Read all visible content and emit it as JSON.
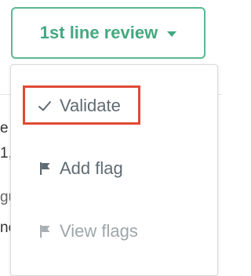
{
  "review_button": {
    "label": "1st line review",
    "caret_icon": "caret-down-icon",
    "accent_color": "#45a880"
  },
  "menu": {
    "items": [
      {
        "label": "Validate",
        "icon": "check-icon",
        "highlighted": true,
        "highlight_color": "#e04a36"
      },
      {
        "label": "Add flag",
        "icon": "flag-icon"
      },
      {
        "label": "View flags",
        "icon": "flag-icon",
        "disabled": true
      }
    ]
  },
  "background": {
    "fragments": [
      "e",
      "1,",
      "gu",
      "nc"
    ]
  }
}
